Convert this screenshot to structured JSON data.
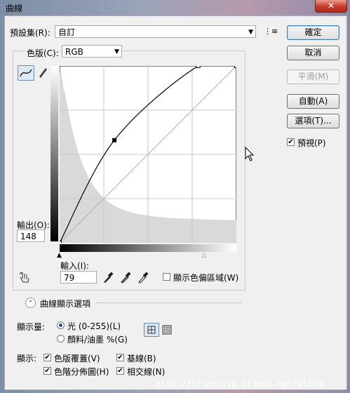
{
  "window": {
    "title": "曲線",
    "close_glyph": "✕"
  },
  "preset": {
    "label": "預設集(R):",
    "value": "自訂",
    "menu_glyph": "⋮≡"
  },
  "channel": {
    "label": "色版(C):",
    "value": "RGB"
  },
  "buttons": {
    "ok": "確定",
    "cancel": "取消",
    "smooth": "平滑(M)",
    "auto": "自動(A)",
    "options": "選項(T)..."
  },
  "preview": {
    "label": "預視(P)",
    "checked": true
  },
  "output": {
    "label": "輸出(O):",
    "value": "148"
  },
  "input": {
    "label": "輸入(I):",
    "value": "79"
  },
  "show_clipping": {
    "label": "顯示色偏區域(W)",
    "checked": false
  },
  "curve_options": {
    "label": "曲線顯示選項"
  },
  "show_amount": {
    "label": "顯示量:",
    "options": [
      {
        "label": "光 (0-255)(L)",
        "selected": true
      },
      {
        "label": "顏料/油墨 %(G)",
        "selected": false
      }
    ]
  },
  "show": {
    "label": "顯示:",
    "items": [
      {
        "label": "色版覆蓋(V)",
        "checked": true
      },
      {
        "label": "基線(B)",
        "checked": true
      },
      {
        "label": "色階分佈圖(H)",
        "checked": true
      },
      {
        "label": "相交線(N)",
        "checked": true
      }
    ]
  },
  "watermark": "http://lccnetvip.pixnet.net/album",
  "curve": {
    "points": [
      [
        0,
        0
      ],
      [
        79,
        148
      ],
      [
        200,
        255
      ],
      [
        255,
        255
      ]
    ],
    "curve_color": "#000000",
    "histogram_color": "#d9d9d9"
  }
}
